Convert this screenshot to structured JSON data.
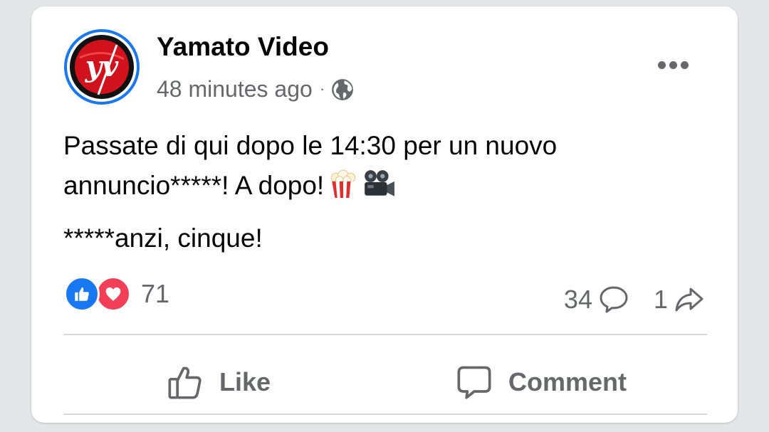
{
  "post": {
    "page_name": "Yamato Video",
    "timestamp": "48 minutes ago",
    "separator": "·",
    "privacy_icon": "globe-icon",
    "avatar_initials": "yv",
    "text_line1": "Passate di qui dopo le 14:30 per un nuovo annuncio*****! A dopo!",
    "text_line2": "*****anzi, cinque!",
    "emoji": [
      "popcorn",
      "movie-camera"
    ]
  },
  "stats": {
    "reaction_count": "71",
    "reactions": [
      "like",
      "love"
    ],
    "comment_count": "34",
    "share_count": "1"
  },
  "actions": {
    "like_label": "Like",
    "comment_label": "Comment"
  },
  "colors": {
    "accent": "#1877f2",
    "love": "#f33e58",
    "secondary_text": "#65676b",
    "primary_text": "#050505",
    "avatar_red": "#d1121c"
  }
}
